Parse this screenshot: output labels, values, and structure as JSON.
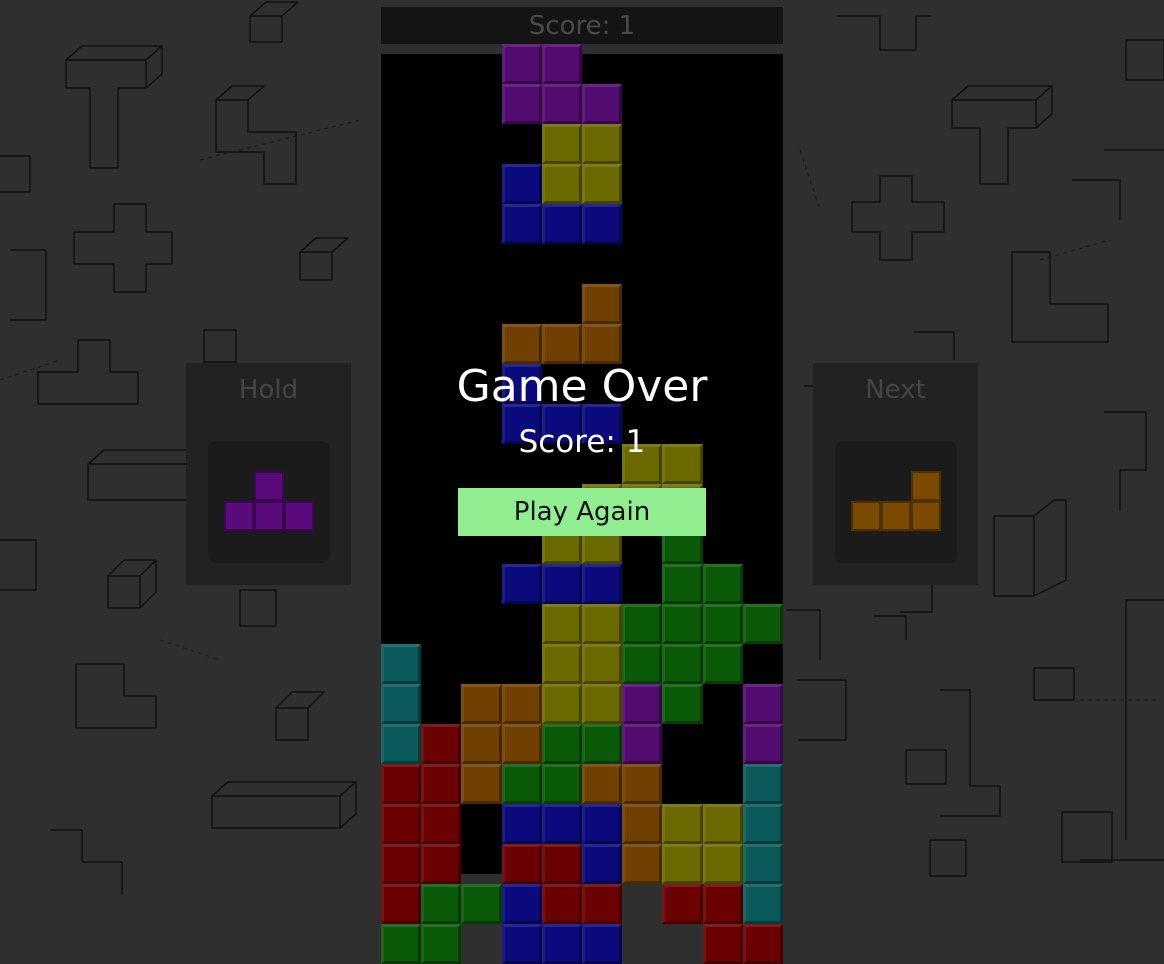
{
  "score_bar": {
    "label": "Score: 1"
  },
  "hold": {
    "title": "Hold",
    "piece": "T",
    "color": "#5a0a7a"
  },
  "next": {
    "title": "Next",
    "piece": "L",
    "color": "#7a4a00"
  },
  "game_over": {
    "title": "Game Over",
    "score_label": "Score: 1",
    "button_label": "Play Again"
  },
  "colors": {
    "P": "#520b6e",
    "Y": "#6a6a00",
    "B": "#0a0a7c",
    "O": "#704000",
    "C": "#0a5a5a",
    "R": "#6a0000",
    "G": "#0a5a0a",
    "background": "#2f2f2f",
    "button": "#90ee90"
  },
  "board": [
    "...PP.....",
    "...PPP....",
    "....YY....",
    "...BYY....",
    "...BBB....",
    "..........",
    ".....O....",
    "...OOO....",
    "...B......",
    "...BBB....",
    "......YY..",
    ".....YYY..",
    "....YY.G..",
    "...BBB.GG.",
    "....YYGGGG",
    "C...YYGGG.",
    "C.OOYYPG.P",
    "CROOGGP..P",
    "RROGGOO..C",
    "RR.BBBOYYC",
    "RR.RRBOYYC",
    "RGGBRR.RRC",
    "GG.BBB..RR"
  ]
}
